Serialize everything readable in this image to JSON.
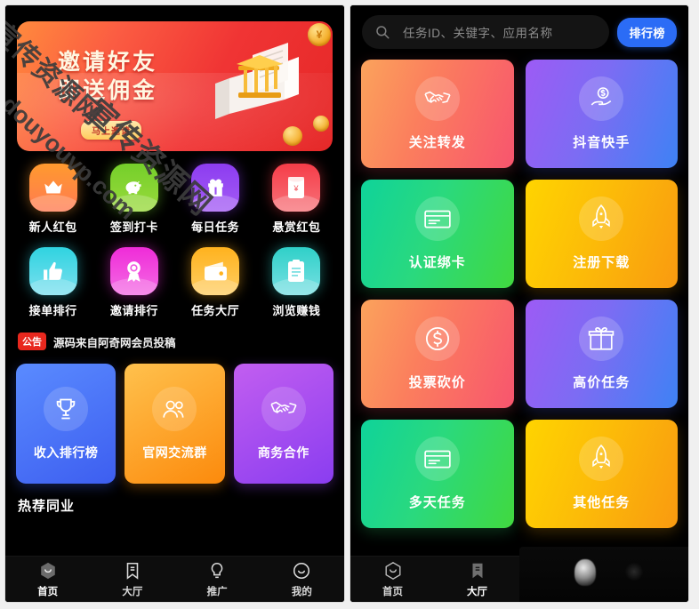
{
  "watermark": {
    "line1": "宣传资源网",
    "line2": "douyouvp.com",
    "line3": "宣传资源网"
  },
  "left": {
    "banner": {
      "title_line1": "邀请好友",
      "title_line2": "即送佣金",
      "cta_label": "马上邀请",
      "coin_symbol": "¥"
    },
    "grid": [
      {
        "label": "新人红包",
        "icon": "crown-icon",
        "color_top": "#ff9a2e",
        "color_bottom": "#ff7a52"
      },
      {
        "label": "签到打卡",
        "icon": "piggy-bank-icon",
        "color_top": "#74cf2a",
        "color_bottom": "#9ada3c"
      },
      {
        "label": "每日任务",
        "icon": "gift-icon",
        "color_top": "#8c3cf0",
        "color_bottom": "#a45cf5"
      },
      {
        "label": "悬赏红包",
        "icon": "red-packet-icon",
        "color_top": "#f53c48",
        "color_bottom": "#f8737a"
      },
      {
        "label": "接单排行",
        "icon": "thumbs-up-icon",
        "color_top": "#2fd3e0",
        "color_bottom": "#7ce0ef"
      },
      {
        "label": "邀请排行",
        "icon": "medal-icon",
        "color_top": "#ef2bd8",
        "color_bottom": "#f46ce4"
      },
      {
        "label": "任务大厅",
        "icon": "wallet-icon",
        "color_top": "#ffb21e",
        "color_bottom": "#ffce63"
      },
      {
        "label": "浏览赚钱",
        "icon": "clipboard-icon",
        "color_top": "#2fd0c8",
        "color_bottom": "#79e0e3"
      }
    ],
    "notice": {
      "badge": "公告",
      "text": "源码来自阿奇网会员投稿"
    },
    "cards": [
      {
        "label": "收入排行榜",
        "icon": "trophy-icon",
        "theme": "blue"
      },
      {
        "label": "官网交流群",
        "icon": "people-icon",
        "theme": "orange"
      },
      {
        "label": "商务合作",
        "icon": "handshake-icon",
        "theme": "purple"
      }
    ],
    "section_title": "热荐同业",
    "tabs": [
      {
        "label": "首页",
        "icon": "home-hex-smile-icon",
        "active": true
      },
      {
        "label": "大厅",
        "icon": "bookmark-icon",
        "active": false
      },
      {
        "label": "推广",
        "icon": "lightbulb-icon",
        "active": false
      },
      {
        "label": "我的",
        "icon": "smiley-face-icon",
        "active": false
      }
    ]
  },
  "right": {
    "search": {
      "placeholder": "任务ID、关键字、应用名称",
      "value": "",
      "icon": "search-icon"
    },
    "rank_button": {
      "label": "排行榜",
      "color": "#2b6cf6"
    },
    "tiles": [
      {
        "label": "关注转发",
        "icon": "handshake-icon",
        "theme": "t-sunset"
      },
      {
        "label": "抖音快手",
        "icon": "hand-dollar-icon",
        "theme": "t-violet"
      },
      {
        "label": "认证绑卡",
        "icon": "credit-card-icon",
        "theme": "t-green"
      },
      {
        "label": "注册下载",
        "icon": "rocket-icon",
        "theme": "t-amber"
      },
      {
        "label": "投票砍价",
        "icon": "dollar-circle-icon",
        "theme": "t-sunset"
      },
      {
        "label": "高价任务",
        "icon": "gift-icon",
        "theme": "t-violet"
      },
      {
        "label": "多天任务",
        "icon": "credit-card-icon",
        "theme": "t-green"
      },
      {
        "label": "其他任务",
        "icon": "rocket-icon",
        "theme": "t-amber"
      }
    ],
    "tabs": [
      {
        "label": "首页",
        "icon": "home-hex-smile-icon",
        "active": false
      },
      {
        "label": "大厅",
        "icon": "bookmark-icon",
        "active": true
      }
    ]
  }
}
